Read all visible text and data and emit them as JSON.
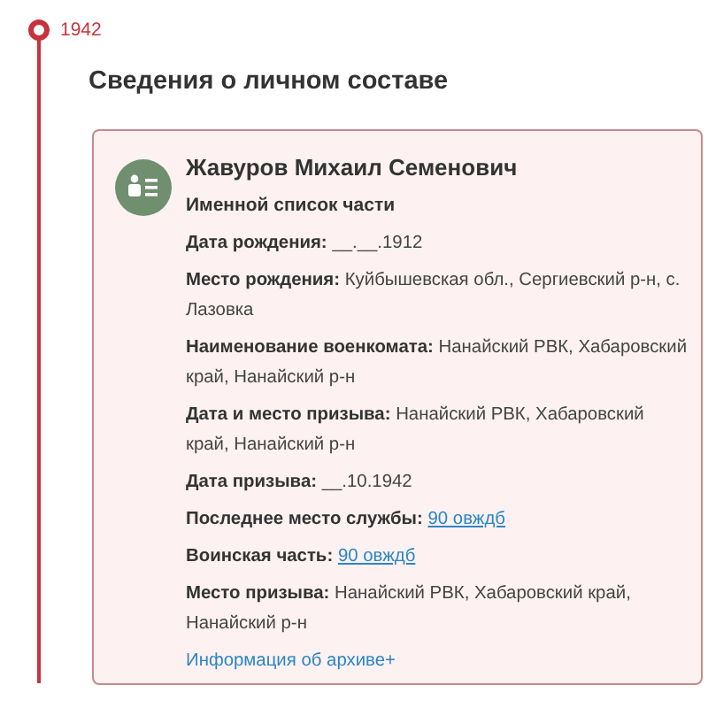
{
  "timeline": {
    "year": "1942"
  },
  "section_title": "Сведения о личном составе",
  "record": {
    "name": "Жавуров Михаил Семенович",
    "source": "Именной список части",
    "fields": [
      {
        "kind": "text",
        "label": "Дата рождения:",
        "value": "__.__.1912"
      },
      {
        "kind": "text",
        "label": "Место рождения:",
        "value": "Куйбышевская обл., Сергиевский р-н, с. Лазовка"
      },
      {
        "kind": "text",
        "label": "Наименование военкомата:",
        "value": "Нанайский РВК, Хабаровский край, Нанайский р-н"
      },
      {
        "kind": "text",
        "label": "Дата и место призыва:",
        "value": "Нанайский РВК, Хабаровский край, Нанайский р-н"
      },
      {
        "kind": "text",
        "label": "Дата призыва:",
        "value": "__.10.1942"
      },
      {
        "kind": "link",
        "label": "Последнее место службы:",
        "value": "90 овждб"
      },
      {
        "kind": "link",
        "label": "Воинская часть:",
        "value": "90 овждб"
      },
      {
        "kind": "text",
        "label": "Место призыва:",
        "value": "Нанайский РВК, Хабаровский край, Нанайский р-н"
      }
    ],
    "archive_link": "Информация об архиве+"
  }
}
